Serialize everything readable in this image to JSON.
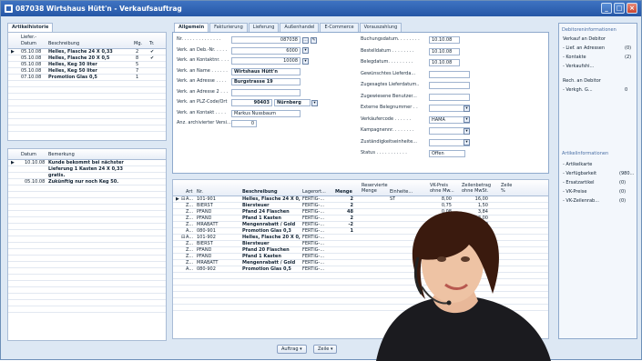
{
  "window": {
    "title": "087038 Wirtshaus Hütt'n - Verkaufsauftrag",
    "min": "_",
    "max": "□",
    "close": "×"
  },
  "left": {
    "tab": "Artikelhistorie",
    "hist_headers": {
      "lief": "Liefer.-",
      "datum": "Datum",
      "beschr": "Beschreibung",
      "mg": "Mg.",
      "tr": "Tr."
    },
    "hist_rows": [
      {
        "datum": "05.10.08",
        "beschr": "Helles, Flasche 24 X 0,33",
        "mg": "2",
        "tr": "✔"
      },
      {
        "datum": "05.10.08",
        "beschr": "Helles, Flasche 20 X 0,5",
        "mg": "8",
        "tr": "✔"
      },
      {
        "datum": "05.10.08",
        "beschr": "Helles, Keg 30 liter",
        "mg": "5",
        "tr": ""
      },
      {
        "datum": "05.10.08",
        "beschr": "Helles, Keg 50 liter",
        "mg": "7",
        "tr": ""
      },
      {
        "datum": "07.10.08",
        "beschr": "Promotion Glas 0,5",
        "mg": "1",
        "tr": ""
      }
    ],
    "note_headers": {
      "datum": "Datum",
      "bem": "Bemerkung"
    },
    "note_rows": [
      {
        "datum": "10.10.08",
        "bem": "Kunde bekommt bei nächster"
      },
      {
        "datum": "",
        "bem": "Lieferung 1 Kasten 24 X 0,33"
      },
      {
        "datum": "",
        "bem": "gratis."
      },
      {
        "datum": "05.10.08",
        "bem": "Zukünftig nur noch Keg 50."
      }
    ]
  },
  "tabs": [
    "Allgemein",
    "Fakturierung",
    "Lieferung",
    "Außenhandel",
    "E-Commerce",
    "Vorauszahlung"
  ],
  "form_left": [
    {
      "label": "Nr. . . . . . . . . . . . . .",
      "value": "087038"
    },
    {
      "label": "Verk. an Deb.-Nr. . . . .",
      "value": "6000"
    },
    {
      "label": "Verk. an Kontaktnr. . . .",
      "value": "10008"
    },
    {
      "label": "Verk. an Name . . . . . .",
      "value": "Wirtshaus Hütt'n"
    },
    {
      "label": "Verk. an Adresse . . . .",
      "value": "Burgstrasse 19"
    },
    {
      "label": "Verk. an Adresse 2 . . .",
      "value": ""
    },
    {
      "label": "Verk. an PLZ-Code/Ort",
      "value": "90403",
      "city": "Nürnberg"
    },
    {
      "label": "Verk. an Kontakt . . . .",
      "value": "Markus Nussbaum"
    },
    {
      "label": "Anz. archivierter Versi...",
      "value": "0"
    }
  ],
  "form_right": [
    {
      "label": "Buchungsdatum. . . . . . . .",
      "value": "10.10.08"
    },
    {
      "label": "Bestelldatum . . . . . . . .",
      "value": "10.10.08"
    },
    {
      "label": "Belegdatum. . . . . . . . .",
      "value": "10.10.08"
    },
    {
      "label": "Gewünschtes Lieferda...",
      "value": ""
    },
    {
      "label": "Zugesagtes Lieferdatum..",
      "value": ""
    },
    {
      "label": "Zugewiesene Benutzer...",
      "value": ""
    },
    {
      "label": "Externe Belegnummer . .",
      "value": ""
    },
    {
      "label": "Verkäufercode . . . . . .",
      "value": "HAMA"
    },
    {
      "label": "Kampagnennr. . . . . . . .",
      "value": ""
    },
    {
      "label": "Zuständigkeitseinheite...",
      "value": ""
    },
    {
      "label": "Status . . . . . . . . . . .",
      "value": "Offen"
    }
  ],
  "lines": {
    "headers": {
      "art": "Art",
      "nr": "Nr.",
      "beschr": "Beschreibung",
      "lager": "Lagerort...",
      "menge": "Menge",
      "res": "Reservierte Menge",
      "einheit": "Einheite...",
      "vk": "VK-Preis ohne Mw...",
      "zeilen": "Zeilenbetrag ohne MwSt.",
      "zeile": "Zeile %"
    },
    "rows": [
      {
        "art": "A...",
        "nr": "101-901",
        "beschr": "Helles, Flasche 24 X 0,33",
        "lager": "FERTIG-...",
        "menge": "2",
        "einheit": "ST",
        "vk": "8,00",
        "zeilen": "16,00"
      },
      {
        "art": "Z...",
        "nr": "BIERST",
        "beschr": "Biersteuer",
        "lager": "FERTIG-...",
        "menge": "2",
        "einheit": "",
        "vk": "0,75",
        "zeilen": "1,50"
      },
      {
        "art": "Z...",
        "nr": "PFAND",
        "beschr": "Pfand 24 Flaschen",
        "lager": "FERTIG-...",
        "menge": "48",
        "einheit": "",
        "vk": "0,08",
        "zeilen": "3,84"
      },
      {
        "art": "Z...",
        "nr": "PFAND",
        "beschr": "Pfand 1 Kasten",
        "lager": "FERTIG-...",
        "menge": "2",
        "einheit": "",
        "vk": "1,50",
        "zeilen": "3,00"
      },
      {
        "art": "Z...",
        "nr": "MRABATT",
        "beschr": "Mengenrabatt / Gold",
        "lager": "FERTIG-...",
        "menge": "-2",
        "einheit": "",
        "vk": "0,40",
        "zeilen": "-0,80"
      },
      {
        "art": "A...",
        "nr": "080-901",
        "beschr": "Promotion Glas 0,3",
        "lager": "FERTIG-...",
        "menge": "1",
        "einheit": "",
        "vk": "",
        "zeilen": ""
      },
      {
        "art": "A...",
        "nr": "101-902",
        "beschr": "Helles, Flasche 20 X 0,5",
        "lager": "FERTIG-...",
        "menge": "",
        "einheit": "",
        "vk": "",
        "zeilen": "68,00"
      },
      {
        "art": "Z...",
        "nr": "BIERST",
        "beschr": "Biersteuer",
        "lager": "FERTIG-...",
        "menge": "",
        "einheit": "",
        "vk": "",
        "zeilen": "7,52"
      },
      {
        "art": "Z...",
        "nr": "PFAND",
        "beschr": "Pfand 20 Flaschen",
        "lager": "FERTIG-...",
        "menge": "",
        "einheit": "",
        "vk": "",
        "zeilen": "12,80"
      },
      {
        "art": "Z...",
        "nr": "PFAND",
        "beschr": "Pfand 1 Kasten",
        "lager": "FERTIG-...",
        "menge": "",
        "einheit": "",
        "vk": "",
        "zeilen": "12,00"
      },
      {
        "art": "Z...",
        "nr": "MRABATT",
        "beschr": "Mengenrabatt / Gold",
        "lager": "FERTIG-...",
        "menge": "",
        "einheit": "",
        "vk": "",
        "zeilen": "-3,40"
      },
      {
        "art": "A...",
        "nr": "080-902",
        "beschr": "Promotion Glas 0,5",
        "lager": "FERTIG-...",
        "menge": "",
        "einheit": "",
        "vk": "",
        "zeilen": ""
      }
    ],
    "btn_auftrag": "Auftrag",
    "btn_zeile": "Zeile"
  },
  "right_panel": {
    "deb_title": "Debitoreninformationen",
    "deb_items": [
      {
        "label": "Verkauf an Debitor",
        "count": ""
      },
      {
        "label": "- Lief. an Adressen",
        "count": "(0)"
      },
      {
        "label": "- Kontakte",
        "count": "(2)"
      },
      {
        "label": "- Verkaufshi...",
        "count": ""
      },
      {
        "label": "Rech. an Debitor",
        "count": ""
      },
      {
        "label": "- Verkgh. G...",
        "count": "0"
      }
    ],
    "art_title": "Artikelinformationen",
    "art_items": [
      {
        "label": "- Artikelkarte",
        "count": ""
      },
      {
        "label": "- Verfügbarkeit",
        "count": "(980..."
      },
      {
        "label": "- Ersatzartikel",
        "count": "(0)"
      },
      {
        "label": "- VK-Preise",
        "count": "(0)"
      },
      {
        "label": "- VK-Zeilenrab...",
        "count": "(0)"
      }
    ]
  }
}
